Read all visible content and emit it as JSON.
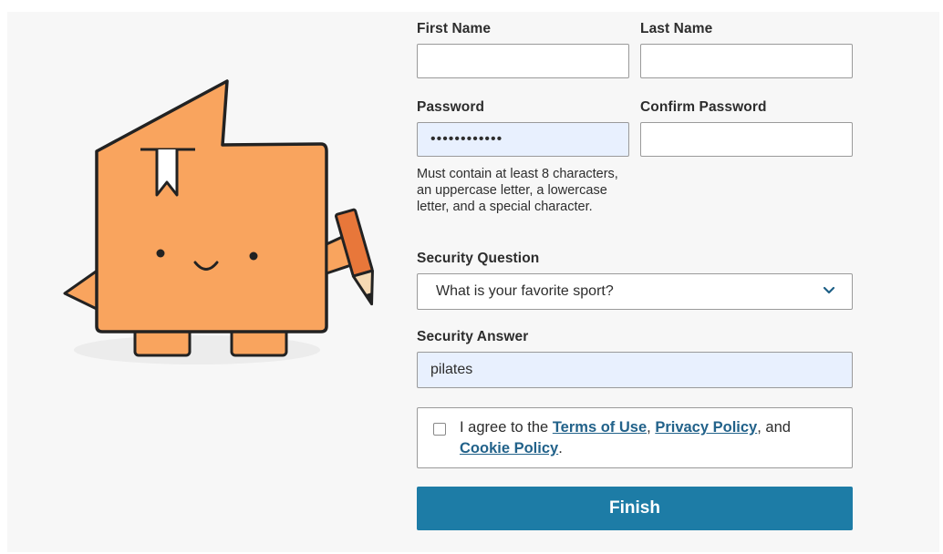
{
  "form": {
    "first_name_label": "First Name",
    "first_name_value": "",
    "last_name_label": "Last Name",
    "last_name_value": "",
    "password_label": "Password",
    "password_value": "••••••••••••",
    "confirm_password_label": "Confirm Password",
    "confirm_password_value": "",
    "password_hint": "Must contain at least 8 characters, an uppercase letter, a lowercase letter, and a special character.",
    "security_question_label": "Security Question",
    "security_question_value": "What is your favorite sport?",
    "security_answer_label": "Security Answer",
    "security_answer_value": "pilates",
    "agree_prefix": "I agree to the ",
    "terms_link": "Terms of Use",
    "comma": ", ",
    "privacy_link": "Privacy Policy",
    "and_text": ", and ",
    "cookie_link": "Cookie Policy",
    "period": ".",
    "agree_checked": false,
    "finish_label": "Finish"
  },
  "colors": {
    "accent": "#1d7ca6",
    "link": "#22628a",
    "filled_field": "#e8f0fe",
    "mascot_body": "#f9a45e"
  },
  "icons": {
    "select_chevron": "chevron-down-icon",
    "mascot": "book-mascot-illustration"
  }
}
